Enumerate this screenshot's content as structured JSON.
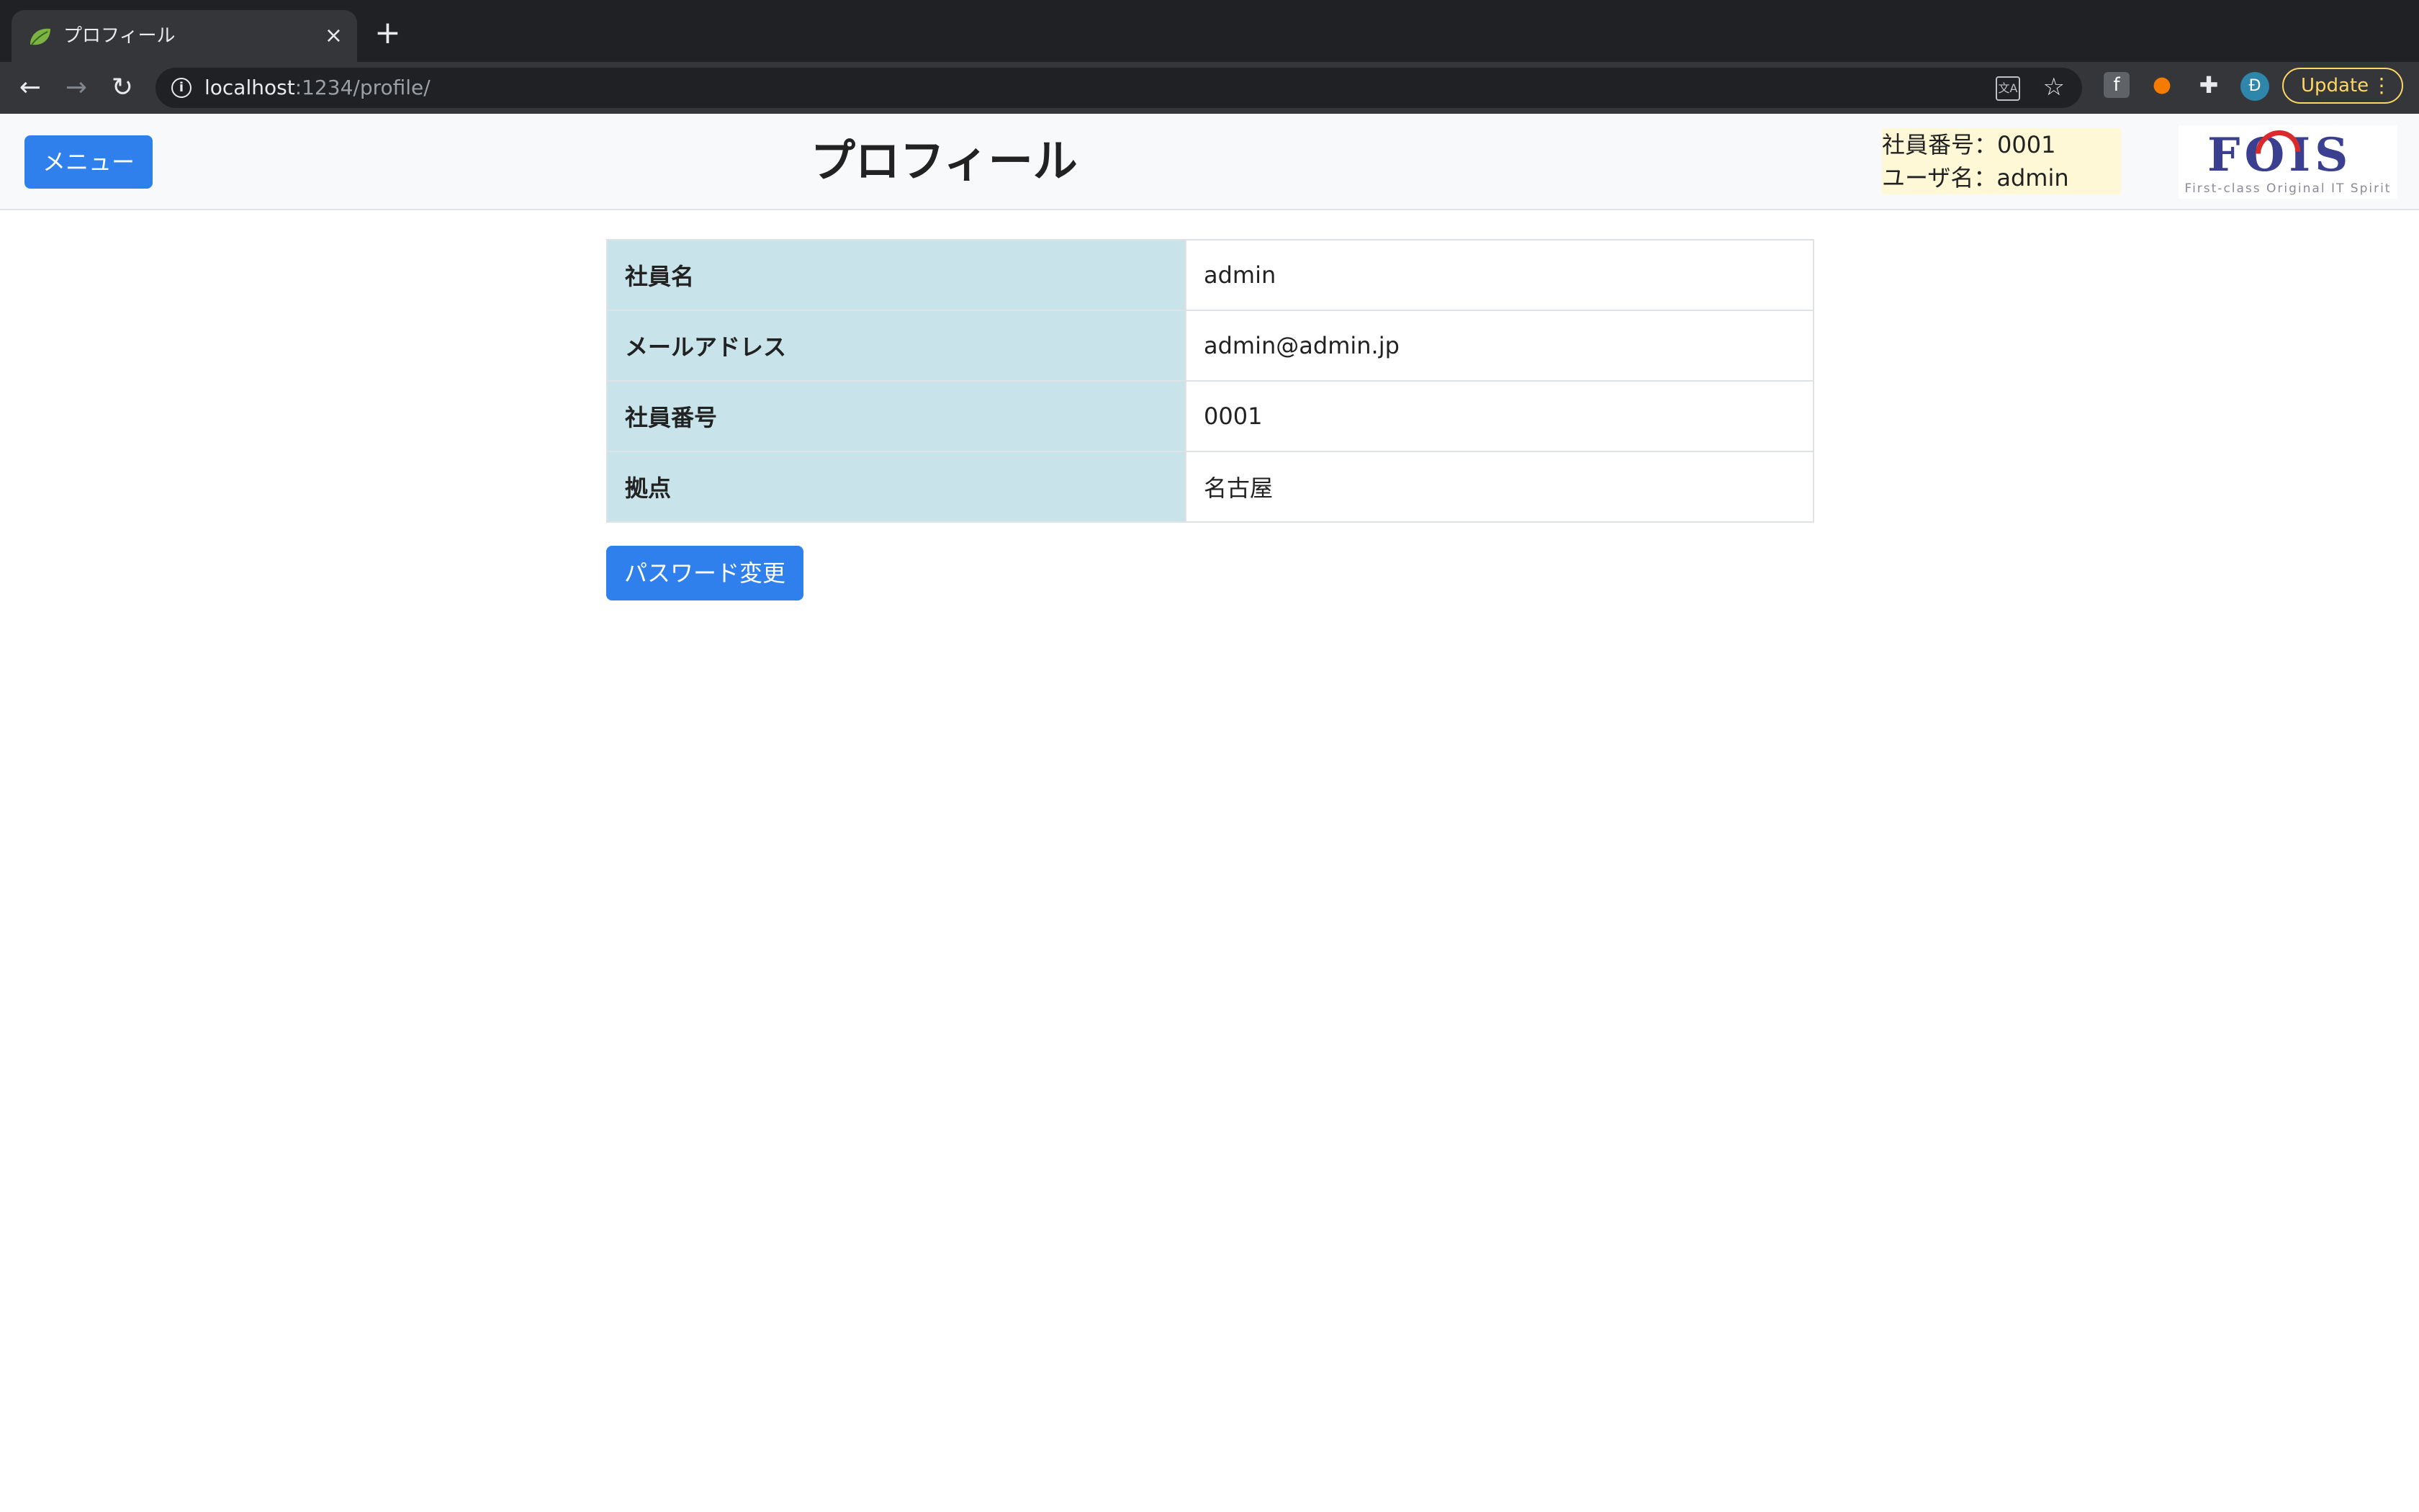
{
  "browser": {
    "tab_title": "プロフィール",
    "tab_close": "×",
    "new_tab": "+",
    "url_host": "localhost",
    "url_path": ":1234/profile/",
    "update_label": "Update",
    "profile_initial": "Đ",
    "icons": [
      "leaf-favicon",
      "back-icon",
      "forward-icon",
      "reload-icon",
      "info-icon",
      "translate-icon",
      "star-icon",
      "facebook-extension-icon",
      "fire-extension-icon",
      "puzzle-extension-icon",
      "kebab-menu-icon"
    ]
  },
  "header": {
    "menu_label": "メニュー",
    "title": "プロフィール",
    "employee_number_line": "社員番号：0001",
    "user_name_line": "ユーザ名：admin",
    "logo_text": "FOIS",
    "logo_tagline": "First-class Original IT Spirit"
  },
  "profile": {
    "rows": [
      {
        "label": "社員名",
        "value": "admin"
      },
      {
        "label": "メールアドレス",
        "value": "admin@admin.jp"
      },
      {
        "label": "社員番号",
        "value": "0001"
      },
      {
        "label": "拠点",
        "value": "名古屋"
      }
    ]
  },
  "actions": {
    "change_password_label": "パスワード変更"
  },
  "colors": {
    "primary_button": "#2f80ed",
    "label_cell_bg": "#c8e4ea",
    "user_box_bg": "#fff8d6",
    "update_accent": "#fdd663"
  }
}
